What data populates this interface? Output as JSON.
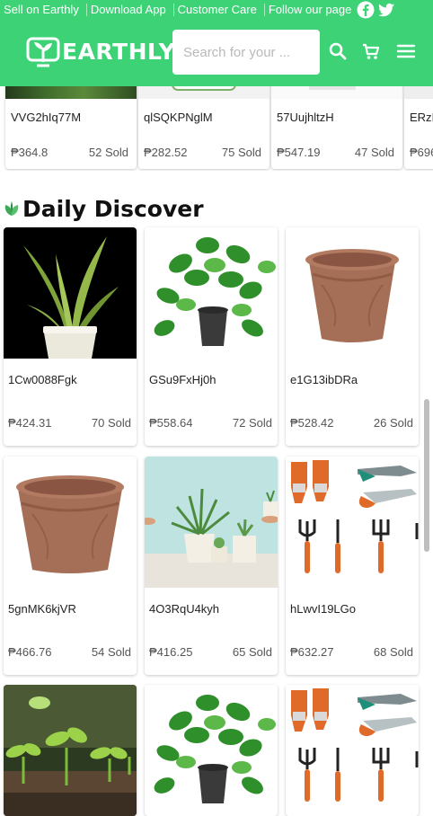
{
  "topbar": {
    "links": [
      "Sell on Earthly",
      "Download App",
      "Customer Care",
      "Follow our page"
    ],
    "social_icons": [
      "facebook-icon",
      "twitter-icon"
    ]
  },
  "header": {
    "brand": "EARTHLY",
    "search_placeholder": "Search for your ...",
    "icons": [
      "search-icon",
      "cart-icon",
      "menu-icon"
    ],
    "brand_color": "#3ed277"
  },
  "strip": {
    "items": [
      {
        "name": "VVG2hIq77M",
        "price": "₱364.8",
        "sold": "52 Sold"
      },
      {
        "name": "qlSQKPNglM",
        "price": "₱282.52",
        "sold": "75 Sold"
      },
      {
        "name": "57UujhltzH",
        "price": "₱547.19",
        "sold": "47 Sold"
      },
      {
        "name": "ERzI",
        "price": "₱696",
        "sold": ""
      }
    ]
  },
  "daily_discover": {
    "title": "Daily Discover",
    "items": [
      {
        "name": "1Cw0088Fgk",
        "price": "₱424.31",
        "sold": "70 Sold",
        "image": "snake-plant"
      },
      {
        "name": "GSu9FxHj0h",
        "price": "₱558.64",
        "sold": "72 Sold",
        "image": "pothos-plant"
      },
      {
        "name": "e1G13ibDRa",
        "price": "₱528.42",
        "sold": "26 Sold",
        "image": "clay-pot"
      },
      {
        "name": "5gnMK6kjVR",
        "price": "₱466.76",
        "sold": "54 Sold",
        "image": "clay-pot"
      },
      {
        "name": "4O3RqU4kyh",
        "price": "₱416.25",
        "sold": "65 Sold",
        "image": "succulents"
      },
      {
        "name": "hLwvI19LGo",
        "price": "₱632.27",
        "sold": "68 Sold",
        "image": "garden-tools"
      },
      {
        "name": "",
        "price": "",
        "sold": "",
        "image": "seedlings"
      },
      {
        "name": "",
        "price": "",
        "sold": "",
        "image": "pothos-plant"
      },
      {
        "name": "",
        "price": "",
        "sold": "",
        "image": "garden-tools"
      }
    ]
  }
}
